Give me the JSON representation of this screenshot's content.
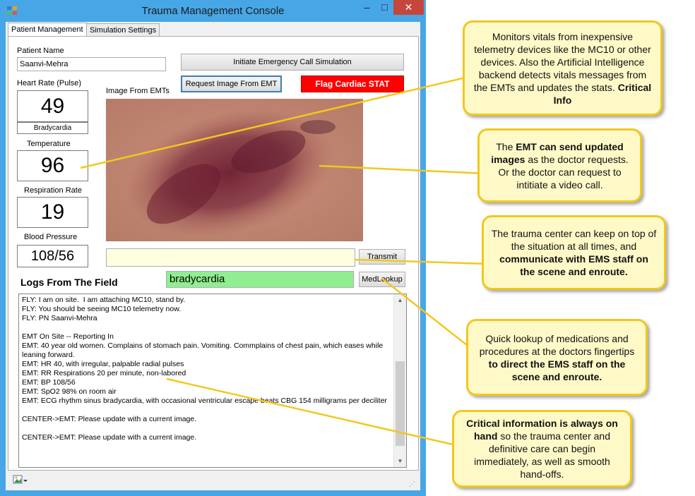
{
  "window": {
    "title": "Trauma Management Console",
    "controls": [
      "–",
      "□",
      "✕"
    ]
  },
  "tabs": [
    {
      "label": "Patient Management",
      "active": true
    },
    {
      "label": "Simulation Settings",
      "active": false
    }
  ],
  "patient": {
    "name_label": "Patient Name",
    "name_value": "Saanvi-Mehra"
  },
  "vitals": {
    "heart_rate_label": "Heart Rate (Pulse)",
    "heart_rate_value": "49",
    "heart_rate_status": "Bradycardia",
    "temperature_label": "Temperature",
    "temperature_value": "96",
    "respiration_label": "Respiration Rate",
    "respiration_value": "19",
    "bp_label": "Blood Pressure",
    "bp_value": "108/56"
  },
  "buttons": {
    "initiate_call": "Initiate Emergency Call Simulation",
    "request_image": "Request Image From EMT",
    "flag_cardiac": "Flag Cardiac STAT",
    "transmit": "Transmit",
    "med_lookup": "MedLookup"
  },
  "image_label": "Image From EMTs",
  "message_input": "",
  "lookup_input": "bradycardia",
  "logs_title": "Logs From The Field",
  "logs": [
    "FLY: I am on site.  I am attaching MC10, stand by.",
    "FLY: You should be seeing MC10 telemetry now.",
    "FLY: PN Saanvi-Mehra",
    "",
    "EMT On Site -- Reporting In",
    "EMT: 40 year old women. Complains of stomach pain. Vomiting. Commplains of chest pain, which eases while",
    "leaning forward.",
    "EMT: HR 40, with irregular, palpable radial pulses",
    "EMT: RR Respirations 20 per minute, non-labored",
    "EMT: BP 108/56",
    "EMT: SpO2 98% on room air",
    "EMT: ECG rhythm sinus bradycardia, with occasional ventricular escape beats CBG 154 milligrams per deciliter",
    "",
    "CENTER->EMT: Please update with a current image.",
    "",
    "CENTER->EMT: Please update with a current image."
  ],
  "callouts": {
    "vitals": {
      "text": "Monitors vitals from inexpensive telemetry devices like the MC10 or other devices. Also the Artificial Intelligence backend detects vitals messages from the EMTs and updates the stats. ",
      "bold": "Critical Info"
    },
    "images": {
      "pre": "The ",
      "bold": "EMT can send updated images",
      "post": " as the doctor requests. Or the doctor can request to intitiate a video call."
    },
    "communicate": {
      "text": "The trauma center can keep on top of the situation at all times, and ",
      "bold": "communicate with EMS staff on the scene and enroute."
    },
    "lookup": {
      "text": "Quick lookup of medications and procedures at the doctors fingertips ",
      "bold": "to direct the EMS staff on the scene and enroute."
    },
    "critical": {
      "bold": "Critical information is always on hand",
      "text": " so the trauma center and definitive care can begin immediately, as well as smooth hand-offs."
    }
  },
  "colors": {
    "flag_red": "#ff0000",
    "lookup_green": "#90ee90",
    "message_yellow": "#ffffe0",
    "callout_fill": "#fff9c8",
    "callout_border": "#f2c81c",
    "window_border": "#47a6e6"
  }
}
